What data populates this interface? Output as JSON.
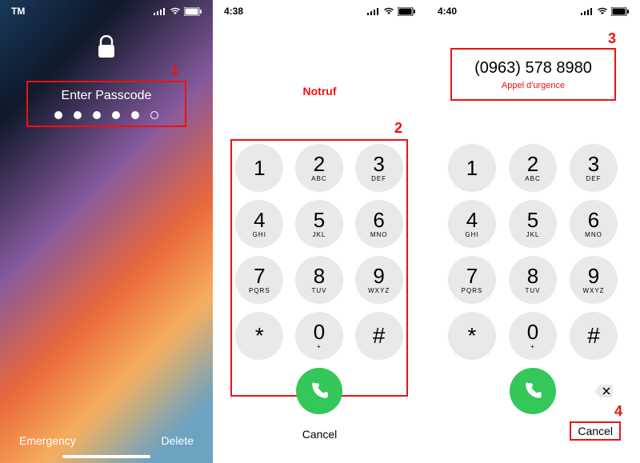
{
  "panel1": {
    "status_left": "TM",
    "passcode_title": "Enter Passcode",
    "passcode_dots": {
      "total": 6,
      "filled": 5
    },
    "annotation": "1",
    "emergency": "Emergency",
    "delete": "Delete"
  },
  "panel2": {
    "time": "4:38",
    "emergency_title": "Notruf",
    "annotation": "2",
    "cancel": "Cancel"
  },
  "panel3": {
    "time": "4:40",
    "dialed_number": "(0963) 578 8980",
    "emergency_sub": "Appel d'urgence",
    "annotation_top": "3",
    "annotation_bottom": "4",
    "cancel": "Cancel"
  },
  "keypad": [
    {
      "num": "1",
      "sub": ""
    },
    {
      "num": "2",
      "sub": "ABC"
    },
    {
      "num": "3",
      "sub": "DEF"
    },
    {
      "num": "4",
      "sub": "GHI"
    },
    {
      "num": "5",
      "sub": "JKL"
    },
    {
      "num": "6",
      "sub": "MNO"
    },
    {
      "num": "7",
      "sub": "PQRS"
    },
    {
      "num": "8",
      "sub": "TUV"
    },
    {
      "num": "9",
      "sub": "WXYZ"
    },
    {
      "num": "*",
      "sub": ""
    },
    {
      "num": "0",
      "sub": "+"
    },
    {
      "num": "#",
      "sub": ""
    }
  ]
}
